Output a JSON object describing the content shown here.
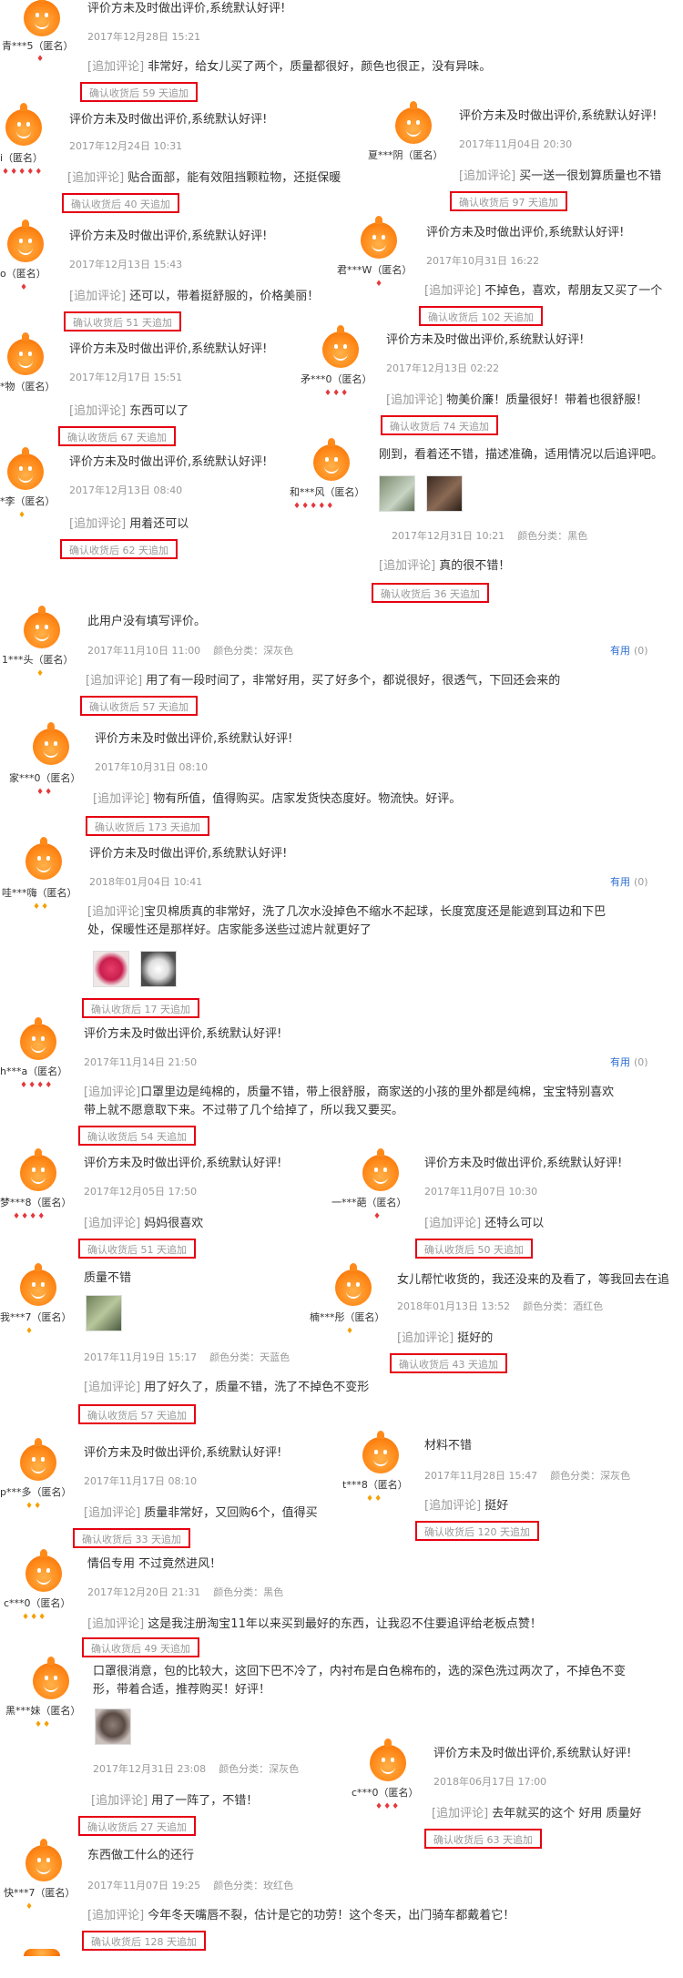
{
  "default_review": "评价方未及时做出评价,系统默认好评!",
  "append_label": "[追加评论]",
  "useful_label": "有用",
  "useful_count": "(0)",
  "anon_suffix": "（匿名）",
  "reviews": [
    {
      "user": "青***5",
      "date": "2017年12月28日 15:21",
      "append": "非常好，给女儿买了两个，质量都很好，颜色也很正，没有异味。",
      "days": "确认收货后 59 天追加"
    },
    {
      "user": "i",
      "date": "2017年12月24日 10:31",
      "append": "贴合面部，能有效阻挡颗粒物，还挺保暖",
      "days": "确认收货后 40 天追加"
    },
    {
      "user": "夏***阴",
      "date": "2017年11月04日 20:30",
      "append": "买一送一很划算质量也不错",
      "days": "确认收货后 97 天追加"
    },
    {
      "user": "o",
      "date": "2017年12月13日 15:43",
      "append": "还可以，带着挺舒服的，价格美丽！",
      "days": "确认收货后 51 天追加"
    },
    {
      "user": "君***W",
      "date": "2017年10月31日 16:22",
      "append": "不掉色，喜欢，帮朋友又买了一个",
      "days": "确认收货后 102 天追加"
    },
    {
      "user": "*物",
      "date": "2017年12月17日 15:51",
      "append": "东西可以了",
      "days": "确认收货后 67 天追加"
    },
    {
      "user": "矛***0",
      "date": "2017年12月13日 02:22",
      "append": "物美价廉！质量很好！带着也很舒服！",
      "days": "确认收货后 74 天追加"
    },
    {
      "user": "*李",
      "date": "2017年12月13日 08:40",
      "append": "用着还可以",
      "days": "确认收货后 62 天追加"
    },
    {
      "user": "和***风",
      "text": "刚到，看着还不错，描述准确，适用情况以后追评吧。",
      "date": "2017年12月31日 10:21",
      "color": "颜色分类：黑色",
      "append": "真的很不错！",
      "days": "确认收货后 36 天追加"
    },
    {
      "user": "1***头",
      "text": "此用户没有填写评价。",
      "date": "2017年11月10日 11:00",
      "color": "颜色分类：深灰色",
      "append": "用了有一段时间了，非常好用，买了好多个，都说很好，很透气，下回还会来的",
      "days": "确认收货后 57 天追加"
    },
    {
      "user": "家***0",
      "date": "2017年10月31日 08:10",
      "append": "物有所值，值得购买。店家发货快态度好。物流快。好评。",
      "days": "确认收货后 173 天追加"
    },
    {
      "user": "哇***嗨",
      "date": "2018年01月04日 10:41",
      "append1": "宝贝棉质真的非常好，洗了几次水没掉色不缩水不起球，长度宽度还是能遮到耳边和下巴",
      "append2": "处，保暖性还是那样好。店家能多送些过滤片就更好了",
      "days": "确认收货后 17 天追加"
    },
    {
      "user": "h***a",
      "date": "2017年11月14日 21:50",
      "append1": "口罩里边是纯棉的，质量不错，带上很舒服，商家送的小孩的里外都是纯棉，宝宝特别喜欢",
      "append2": "带上就不愿意取下来。不过带了几个给掉了，所以我又要买。",
      "days": "确认收货后 54 天追加"
    },
    {
      "user": "梦***8",
      "date": "2017年12月05日 17:50",
      "append": "妈妈很喜欢",
      "days": "确认收货后 51 天追加"
    },
    {
      "user": "一***葩",
      "date": "2017年11月07日 10:30",
      "append": "还特么可以",
      "days": "确认收货后 50 天追加"
    },
    {
      "user": "我***7",
      "text": "质量不错",
      "date": "2017年11月19日 15:17",
      "color": "颜色分类：天蓝色",
      "append": "用了好久了，质量不错，洗了不掉色不变形",
      "days": "确认收货后 57 天追加"
    },
    {
      "user": "楠***彤",
      "text": "女儿帮忙收货的，我还没来的及看了，等我回去在追",
      "date": "2018年01月13日 13:52",
      "color": "颜色分类：酒红色",
      "append": "挺好的",
      "days": "确认收货后 43 天追加"
    },
    {
      "user": "p***多",
      "date": "2017年11月17日 08:10",
      "append": "质量非常好，又回购6个，值得买",
      "days": "确认收货后 33 天追加"
    },
    {
      "user": "t***8",
      "text": "材料不错",
      "date": "2017年11月28日 15:47",
      "color": "颜色分类：深灰色",
      "append": "挺好",
      "days": "确认收货后 120 天追加"
    },
    {
      "user": "c***0",
      "text": "情侣专用 不过竟然进风！",
      "date": "2017年12月20日 21:31",
      "color": "颜色分类：黑色",
      "append": "这是我注册淘宝11年以来买到最好的东西，让我忍不住要追评给老板点赞！",
      "days": "确认收货后 49 天追加"
    },
    {
      "user": "黑***妹",
      "text1": "口罩很消意，包的比较大，这回下巴不冷了，内衬布是白色棉布的，选的深色洗过两次了，不掉色不变",
      "text2": "形，带着合适，推荐购买！好评！",
      "date": "2017年12月31日 23:08",
      "color": "颜色分类：深灰色",
      "append": "用了一阵了，不错！",
      "days": "确认收货后 27 天追加"
    },
    {
      "user": "c***0",
      "date": "2018年06月17日 17:00",
      "append": "去年就买的这个 好用 质量好",
      "days": "确认收货后 63 天追加"
    },
    {
      "user": "快***7",
      "text": "东西做工什么的还行",
      "date": "2017年11月07日 19:25",
      "color": "颜色分类：玫红色",
      "append": "今年冬天嘴唇不裂，估计是它的功劳！这个冬天，出门骑车都戴着它！",
      "days": "确认收货后 128 天追加"
    }
  ]
}
